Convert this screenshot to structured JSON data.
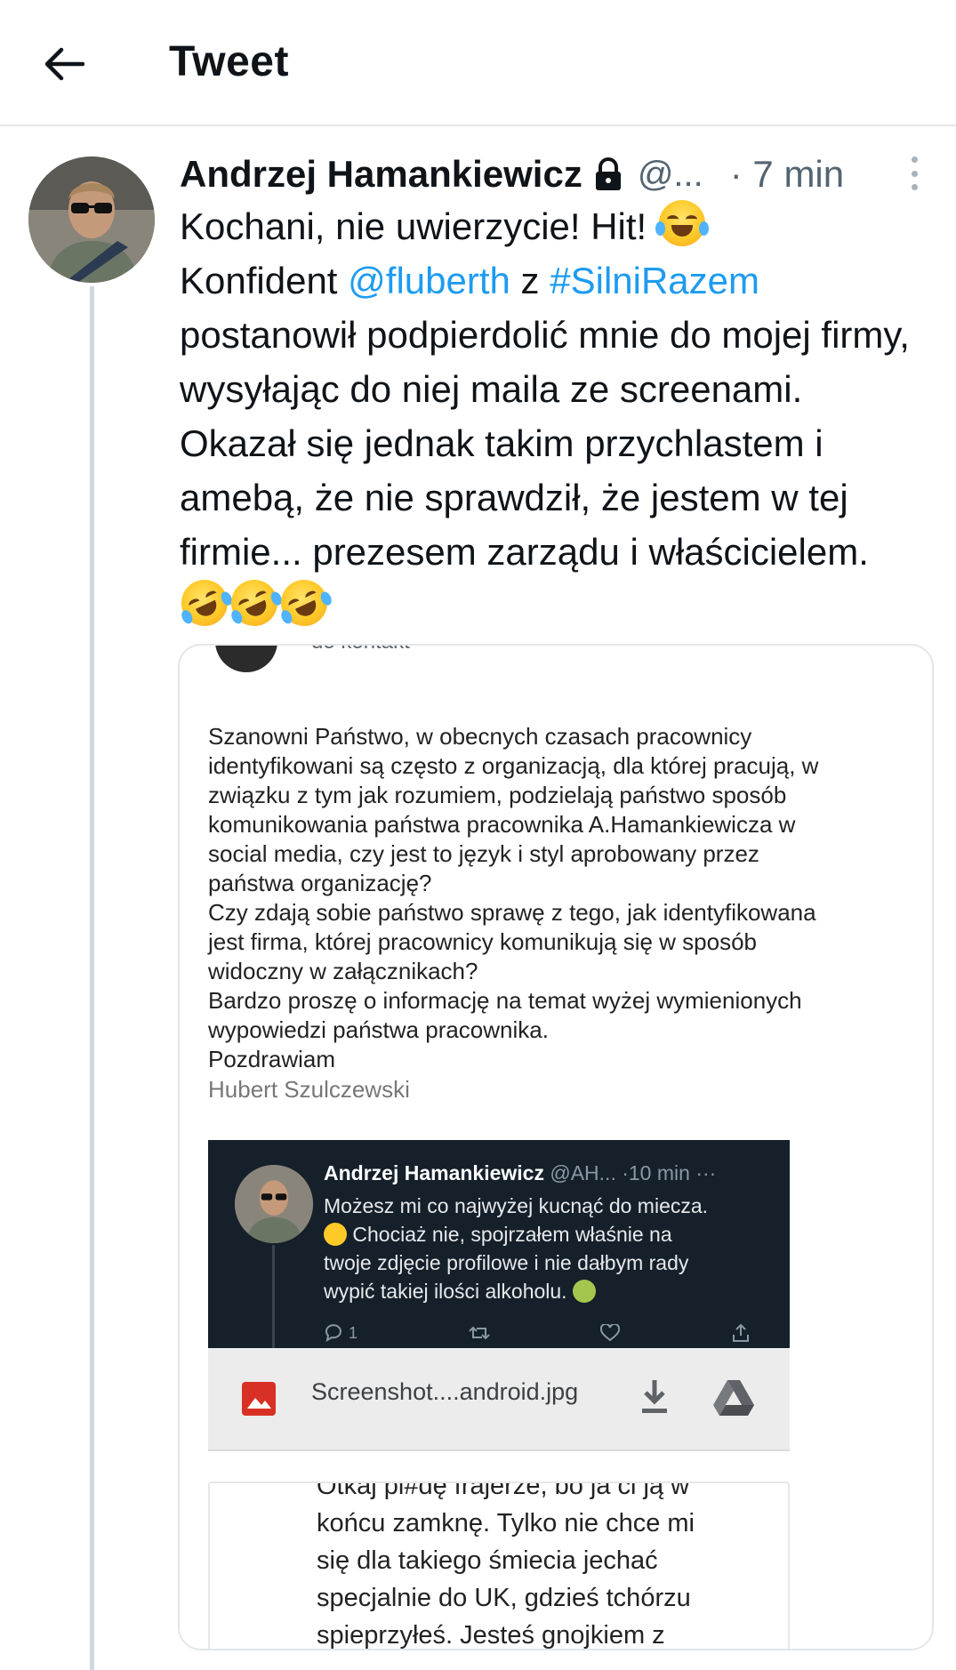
{
  "header": {
    "title": "Tweet"
  },
  "tweet": {
    "author_name": "Andrzej Hamankiewicz",
    "handle": "@...",
    "time": "· 7 min",
    "text_line1": "Kochani, nie uwierzycie! Hit! ",
    "text_konfident": "Konfident ",
    "mention": "@fluberth",
    "text_z": " z ",
    "hashtag": "#SilniRazem",
    "text_rest": "postanowił podpierdolić mnie do mojej firmy, wysyłając do niej maila ze screenami. Okazał się jednak takim przychlastem i amebą, że nie sprawdził, że jestem w tej firmie... prezesem zarządu i właścicielem. "
  },
  "email": {
    "cut_header": "do kontakt",
    "body": "Szanowni Państwo, w obecnych czasach pracownicy\nidentyfikowani są często z organizacją, dla której pracują, w\nzwiązku z tym jak rozumiem, podzielają państwo sposób\nkomunikowania państwa pracownika A.Hamankiewicza w\nsocial media, czy jest to język i styl aprobowany przez\npaństwa organizację?\nCzy zdają sobie państwo sprawę z tego, jak identyfikowana\njest firma, której pracownicy komunikują się w sposób\nwidoczny w załącznikach?\nBardzo proszę o informację na temat wyżej wymienionych\nwypowiedzi państwa pracownika.\nPozdrawiam",
    "signature": "Hubert Szulczewski"
  },
  "screenshot": {
    "name": "Andrzej Hamankiewicz",
    "handle": "@AH...",
    "time": "·10 min",
    "more": "···",
    "text_line1": "Możesz mi co najwyżej kucnąć do miecza.",
    "text_rest": " Chociaż nie, spojrzałem właśnie na\ntwoje zdjęcie profilowe i nie dałbym rady\nwypić takiej ilości alkoholu. ",
    "reply_count": "1"
  },
  "attachment": {
    "file_name": "Screenshot....android.jpg"
  },
  "quote": {
    "text": "Otkaj pi#dę frajerze, bo ja ci ją w\nkońcu zamknę. Tylko nie chce mi\nsię dla takiego śmiecia jechać\nspecjalnie do UK, gdzieś tchórzu\nspieprzyłeś. Jesteś gnojkiem z"
  },
  "icons": {
    "back": "arrow-left-icon",
    "lock": "lock-icon",
    "more": "more-vertical-icon",
    "download": "download-icon",
    "drive": "drive-icon",
    "image": "image-file-icon"
  },
  "colors": {
    "link": "#1d9bf0",
    "secondary_text": "#536471",
    "dark_tweet_bg": "#15202b"
  }
}
